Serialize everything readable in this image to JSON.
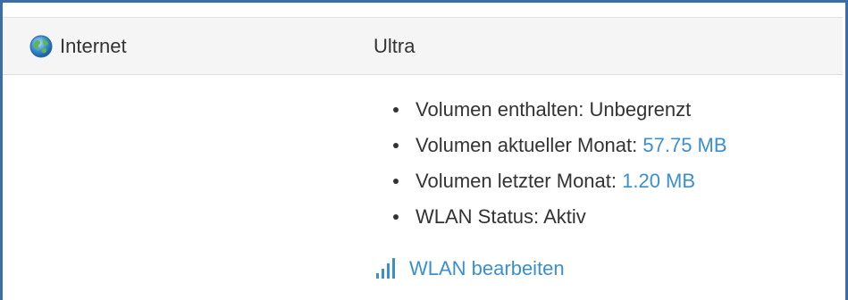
{
  "service": {
    "name": "Internet",
    "icon": "globe-icon",
    "plan": "Ultra"
  },
  "details": [
    {
      "label": "Volumen enthalten: ",
      "value": "Unbegrenzt",
      "value_is_link": false
    },
    {
      "label": "Volumen aktueller Monat: ",
      "value": "57.75 MB",
      "value_is_link": true
    },
    {
      "label": "Volumen letzter Monat: ",
      "value": "1.20 MB",
      "value_is_link": true
    },
    {
      "label": "WLAN Status: ",
      "value": "Aktiv",
      "value_is_link": false
    }
  ],
  "wlan_edit": {
    "label": "WLAN bearbeiten",
    "icon": "signal-bars-icon"
  },
  "colors": {
    "frame_border": "#3a6fa6",
    "header_bg": "#f5f5f5",
    "link": "#3a8fd0",
    "text": "#333333"
  }
}
